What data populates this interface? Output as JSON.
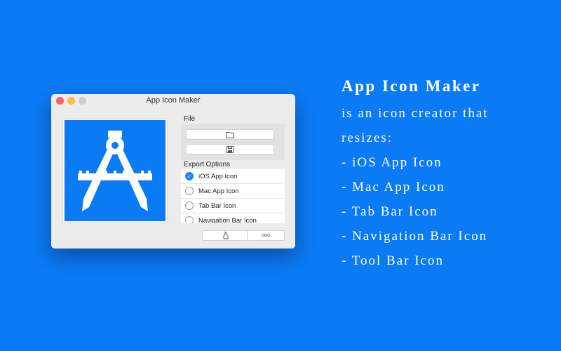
{
  "window": {
    "title": "App Icon Maker"
  },
  "file": {
    "label": "File",
    "open_icon": "folder-icon",
    "save_icon": "floppy-disk-icon"
  },
  "export": {
    "label": "Export Options",
    "options": [
      {
        "label": "iOS App Icon",
        "selected": true
      },
      {
        "label": "Mac App Icon",
        "selected": false
      },
      {
        "label": "Tab Bar Icon",
        "selected": false
      },
      {
        "label": "Navigation Bar Icon",
        "selected": false
      }
    ]
  },
  "bottom": {
    "share_icon": "share-hand-icon",
    "more_label": "ooo"
  },
  "copy": {
    "title": "App Icon Maker",
    "lines": [
      "is an icon creator that",
      "resizes:",
      "- iOS App Icon",
      "- Mac App Icon",
      "- Tab Bar Icon",
      "- Navigation Bar Icon",
      "- Tool Bar Icon"
    ]
  },
  "colors": {
    "background": "#0b7af5",
    "accent": "#1e84f6"
  }
}
